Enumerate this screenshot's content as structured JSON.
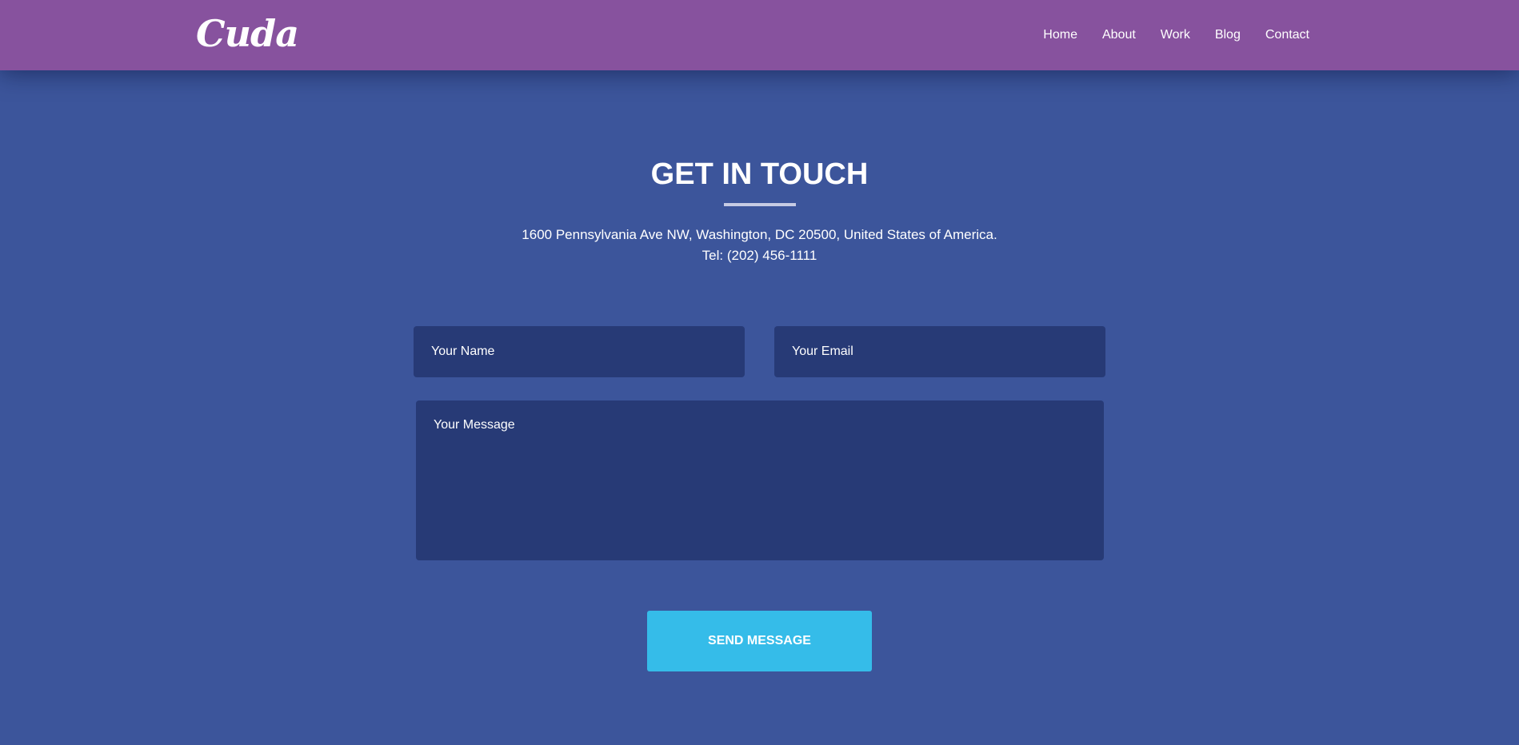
{
  "header": {
    "logo": "Cuda",
    "nav": [
      "Home",
      "About",
      "Work",
      "Blog",
      "Contact"
    ]
  },
  "contact": {
    "title": "GET IN TOUCH",
    "address": "1600 Pennsylvania Ave NW, Washington, DC 20500, United States of America.",
    "phone": "Tel: (202) 456-1111"
  },
  "form": {
    "name_placeholder": "Your Name",
    "email_placeholder": "Your Email",
    "message_placeholder": "Your Message",
    "send_label": "SEND MESSAGE"
  },
  "colors": {
    "header_bg": "#87529e",
    "page_bg": "#3c559b",
    "field_bg": "#273a76",
    "button_bg": "#35bce9"
  }
}
